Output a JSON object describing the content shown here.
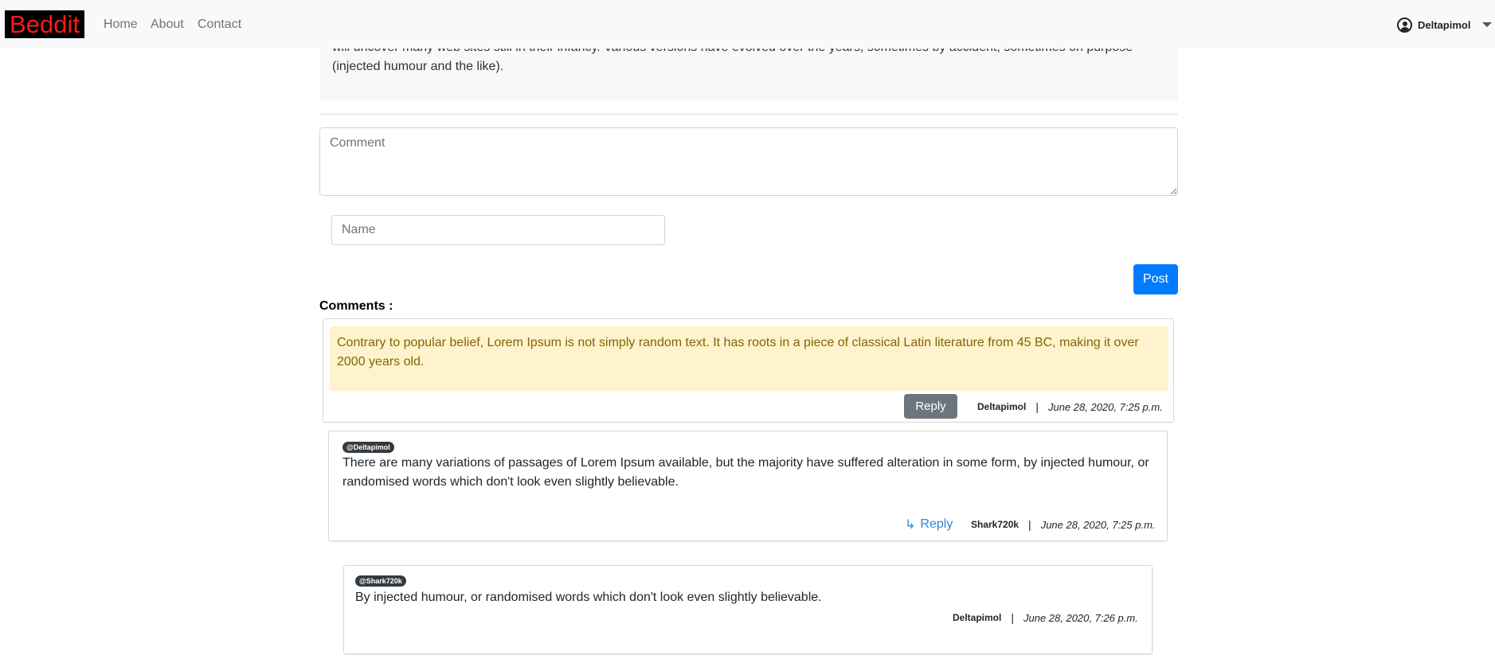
{
  "navbar": {
    "brand": "Beddit",
    "links": [
      "Home",
      "About",
      "Contact"
    ],
    "user": "Deltapimol"
  },
  "post": {
    "text_tail": "will uncover many web sites still in their infancy. Various versions have evolved over the years, sometimes by accident, sometimes on purpose (injected humour and the like)."
  },
  "form": {
    "comment_placeholder": "Comment",
    "name_placeholder": "Name",
    "post_label": "Post"
  },
  "comments": {
    "heading": "Comments :",
    "top": {
      "text": "Contrary to popular belief, Lorem Ipsum is not simply random text. It has roots in a piece of classical Latin literature from 45 BC, making it over 2000 years old.",
      "reply_label": "Reply",
      "author": "Deltapimol",
      "separator": "|",
      "date": "June 28, 2020, 7:25 p.m."
    },
    "replies": [
      {
        "mention": "@Deltapimol",
        "text": "There are many variations of passages of Lorem Ipsum available, but the majority have suffered alteration in some form, by injected humour, or randomised words which don't look even slightly believable.",
        "reply_arrow": "↳",
        "reply_label": "Reply",
        "author": "Shark720k",
        "separator": "|",
        "date": "June 28, 2020, 7:25 p.m."
      },
      {
        "mention": "@Shark720k",
        "text": "By injected humour, or randomised words which don't look even slightly believable.",
        "author": "Deltapimol",
        "separator": "|",
        "date": "June 28, 2020, 7:26 p.m."
      }
    ]
  },
  "colors": {
    "brand_text": "#ff1a1a",
    "primary": "#007bff",
    "secondary": "#6c757d",
    "alert_bg": "#fff3cd",
    "alert_text": "#856404",
    "link": "#2a86d8"
  }
}
